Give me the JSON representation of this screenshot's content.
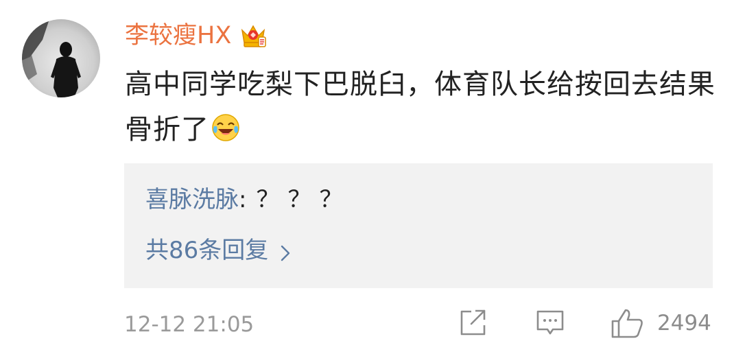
{
  "comment": {
    "username": "李较瘦HX",
    "badge_icon": "vip-crown-icon",
    "text": "高中同学吃梨下巴脱臼，体育队长给按回去结果骨折了",
    "emoji_icon": "laugh-cry-emoji",
    "timestamp": "12-12 21:05"
  },
  "reply_preview": {
    "author": "喜脉洗脉",
    "colon": ":",
    "content": "？？？",
    "more_label": "共86条回复",
    "more_icon": "chevron-right-icon"
  },
  "actions": {
    "forward_icon": "share-icon",
    "comment_icon": "comment-icon",
    "like_icon": "thumb-up-icon",
    "like_count": "2494"
  },
  "colors": {
    "username": "#eb7340",
    "link": "#5b7ba3",
    "reply_bg": "#f2f2f2",
    "muted": "#9a9a9a"
  }
}
